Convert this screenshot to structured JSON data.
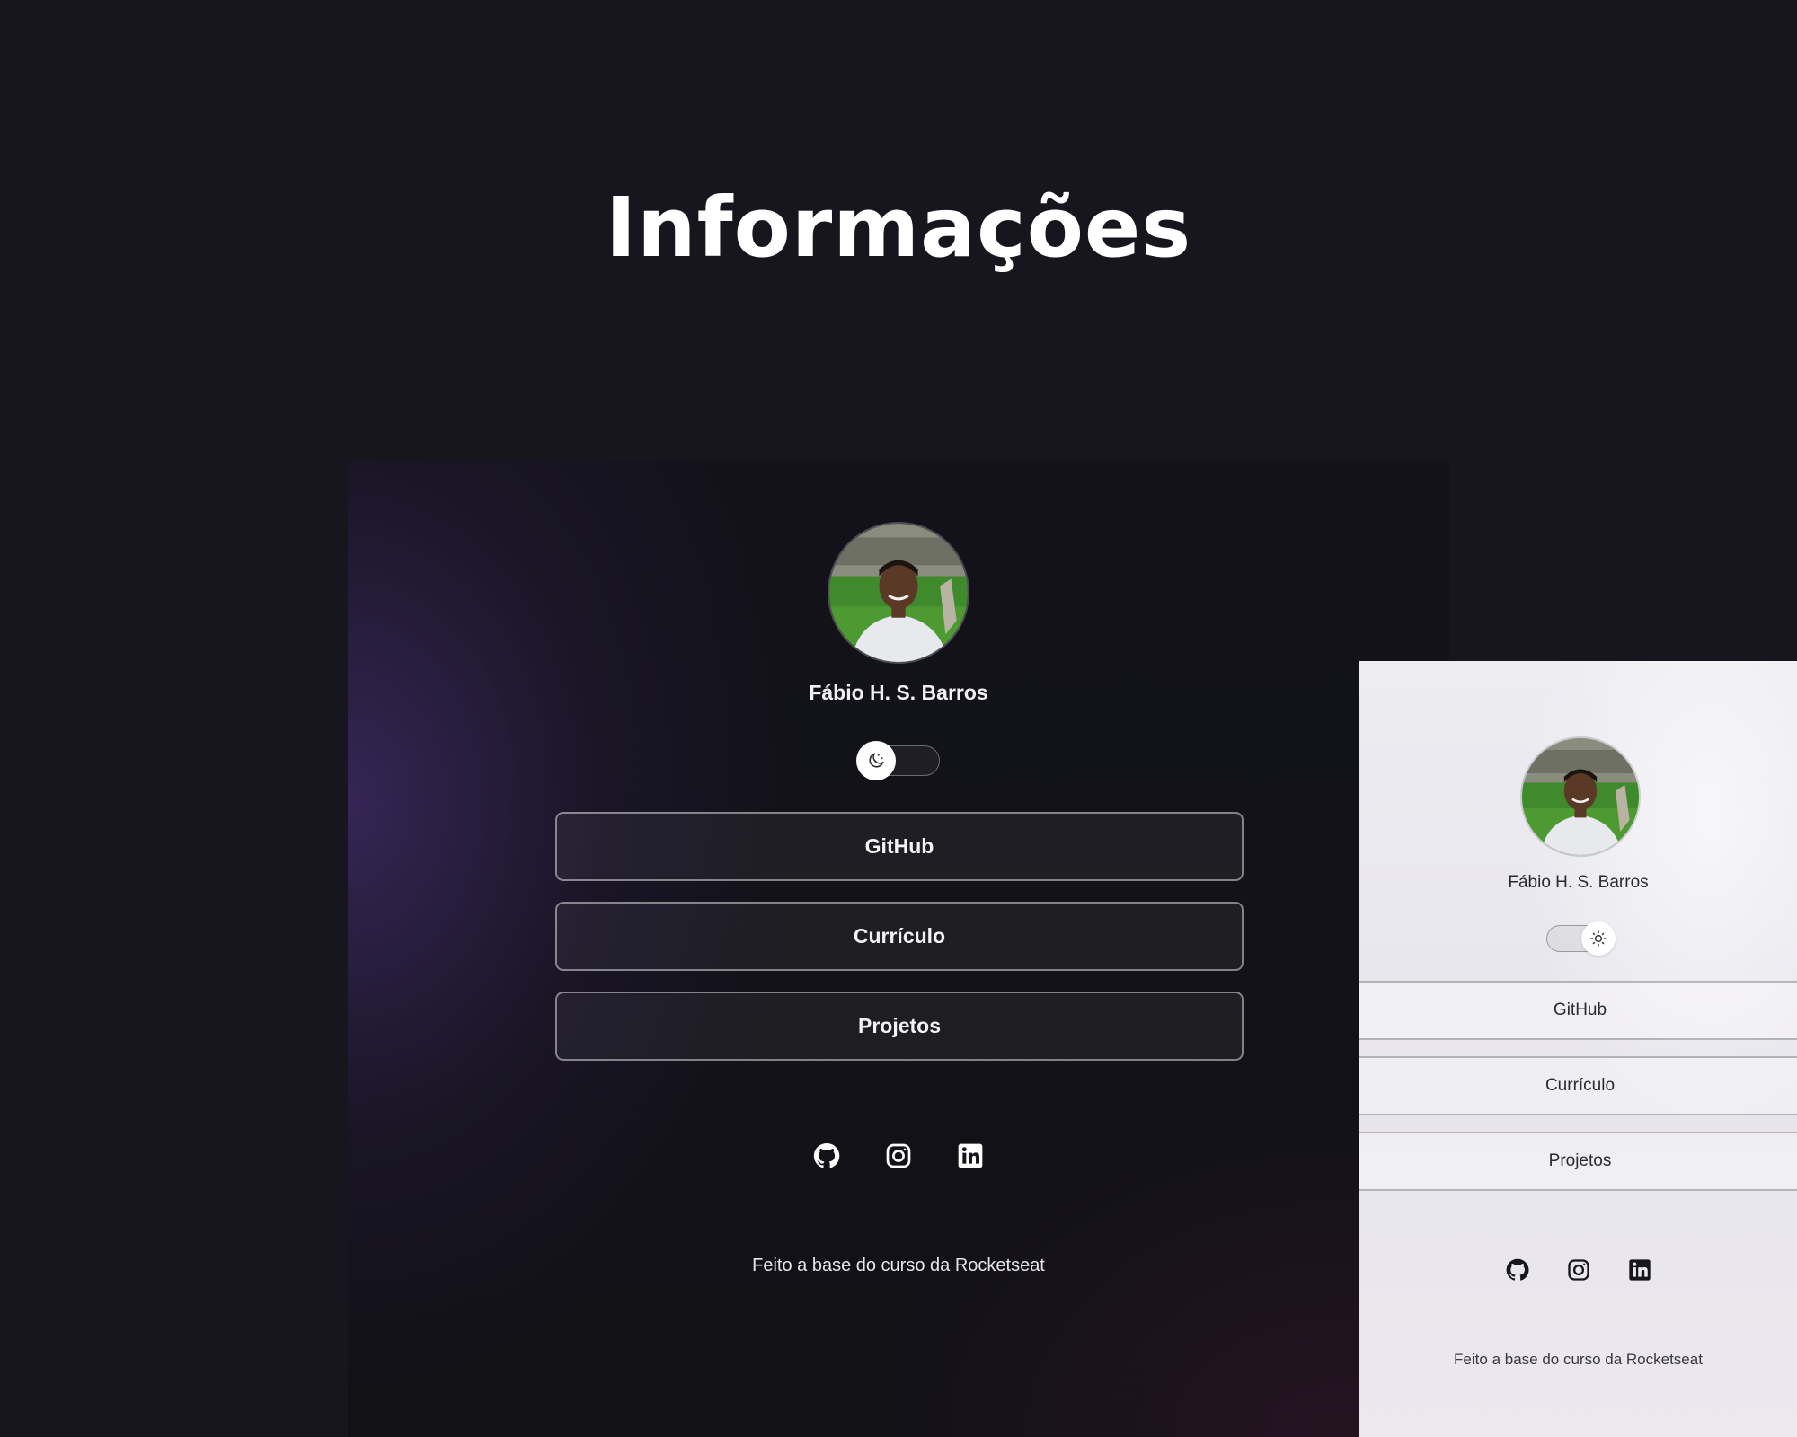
{
  "page": {
    "heading": "Informações"
  },
  "dark_preview": {
    "profile_name": "Fábio H. S. Barros",
    "toggle_icon": "moon-icon",
    "buttons": [
      {
        "label": "GitHub"
      },
      {
        "label": "Currículo"
      },
      {
        "label": "Projetos"
      }
    ],
    "social_icons": [
      "github-icon",
      "instagram-icon",
      "linkedin-icon"
    ],
    "footer": "Feito a base do curso da Rocketseat"
  },
  "light_preview": {
    "profile_name": "Fábio H. S. Barros",
    "toggle_icon": "sun-icon",
    "buttons": [
      {
        "label": "GitHub"
      },
      {
        "label": "Currículo"
      },
      {
        "label": "Projetos"
      }
    ],
    "social_icons": [
      "github-icon",
      "instagram-icon",
      "linkedin-icon"
    ],
    "footer": "Feito a base do curso da Rocketseat"
  },
  "colors": {
    "page_background": "#17151d",
    "dark_accent": "#422c69",
    "light_background": "#ececf1"
  }
}
